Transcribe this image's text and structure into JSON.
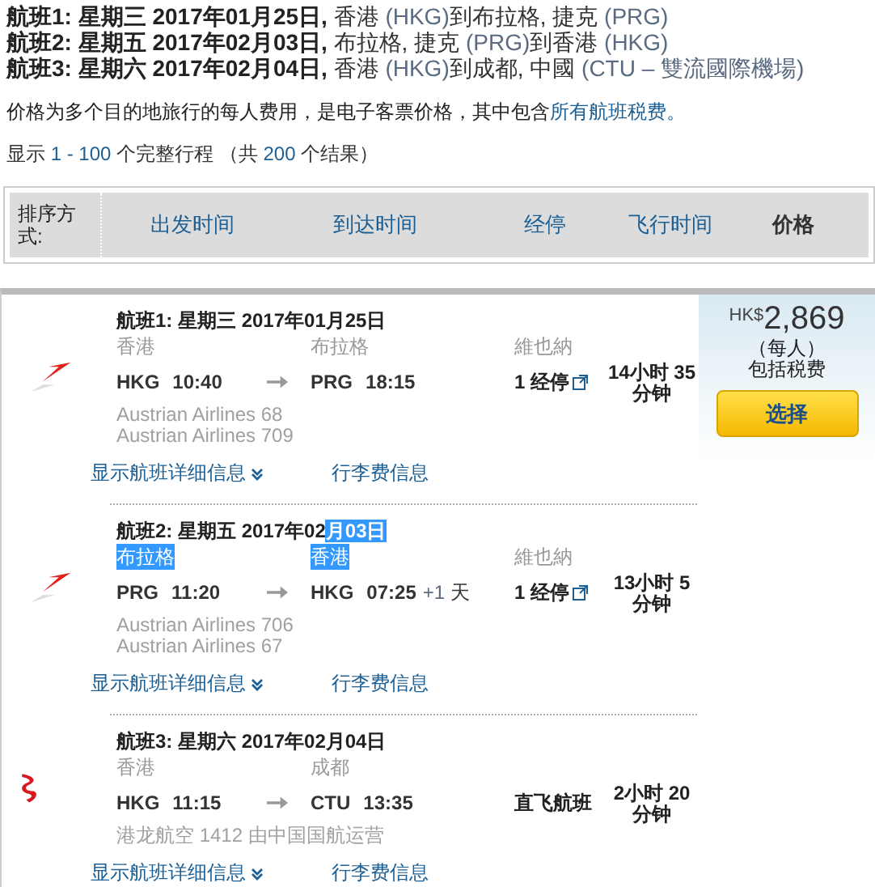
{
  "itinerary_summary": [
    {
      "segments": [
        {
          "text": "航班1: 星期三 2017年01月25日,",
          "kind": "bold"
        },
        {
          "text": " 香港 ",
          "kind": "plain"
        },
        {
          "text": "(HKG)",
          "kind": "code"
        },
        {
          "text": "到布拉格, 捷克 ",
          "kind": "plain"
        },
        {
          "text": "(PRG)",
          "kind": "code"
        }
      ]
    },
    {
      "segments": [
        {
          "text": "航班2: 星期五 2017年02月03日,",
          "kind": "bold"
        },
        {
          "text": " 布拉格, 捷克 ",
          "kind": "plain"
        },
        {
          "text": "(PRG)",
          "kind": "code"
        },
        {
          "text": "到香港 ",
          "kind": "plain"
        },
        {
          "text": "(HKG)",
          "kind": "code"
        }
      ]
    },
    {
      "segments": [
        {
          "text": "航班3: 星期六 2017年02月04日,",
          "kind": "bold"
        },
        {
          "text": " 香港 ",
          "kind": "plain"
        },
        {
          "text": "(HKG)",
          "kind": "code"
        },
        {
          "text": "到成都, 中國 ",
          "kind": "plain"
        },
        {
          "text": "(CTU – 雙流國際機場)",
          "kind": "code"
        }
      ]
    }
  ],
  "notice": {
    "text": "价格为多个目的地旅行的每人费用，是电子客票价格，其中包含",
    "link": "所有航班税费。"
  },
  "results_count": {
    "segments": [
      {
        "text": "显示 ",
        "kind": "plain"
      },
      {
        "text": "1 - 100",
        "kind": "number"
      },
      {
        "text": " 个完整行程 （共 ",
        "kind": "plain"
      },
      {
        "text": "200",
        "kind": "number"
      },
      {
        "text": " 个结果）",
        "kind": "plain"
      }
    ]
  },
  "sort": {
    "label": "排序方式:",
    "options": [
      {
        "label": "出发时间",
        "selected": false
      },
      {
        "label": "到达时间",
        "selected": false
      },
      {
        "label": "经停",
        "selected": false
      },
      {
        "label": "飞行时间",
        "selected": false
      },
      {
        "label": "价格",
        "selected": true
      }
    ]
  },
  "result": {
    "price": {
      "currency": "HK$",
      "amount": "2,869",
      "per_person": "（每人）",
      "tax_note": "包括税费",
      "button": "选择"
    },
    "legs": [
      {
        "kind": "wing",
        "title_parts": [
          {
            "text": "航班1:  星期三 2017年01月25日",
            "highlighted": false
          }
        ],
        "from": {
          "city": "香港",
          "highlighted": false,
          "code": "HKG",
          "time": "10:40"
        },
        "to": {
          "city": "布拉格",
          "highlighted": false,
          "code": "PRG",
          "time": "18:15"
        },
        "via": "維也納",
        "stops": "1 经停",
        "stops_link": true,
        "duration": "14小时 35分钟",
        "flights": [
          "Austrian Airlines 68",
          "Austrian Airlines 709"
        ],
        "details_link": "显示航班详细信息",
        "baggage_link": "行李费信息"
      },
      {
        "kind": "wing",
        "title_parts": [
          {
            "text": "航班2:  星期五 2017年02",
            "highlighted": false
          },
          {
            "text": "月03日",
            "highlighted": true
          }
        ],
        "from": {
          "city": "布拉格",
          "highlighted": true,
          "code": "PRG",
          "time": "11:20"
        },
        "to": {
          "city": "香港",
          "highlighted": true,
          "code": "HKG",
          "time": "07:25",
          "day_offset": "+1",
          "day_unit": "天"
        },
        "via": "維也納",
        "stops": "1 经停",
        "stops_link": true,
        "duration": "13小时 5分钟",
        "flights": [
          "Austrian Airlines 706",
          "Austrian Airlines 67"
        ],
        "details_link": "显示航班详细信息",
        "baggage_link": "行李费信息"
      },
      {
        "kind": "dragon",
        "title_parts": [
          {
            "text": "航班3:  星期六 2017年02月04日",
            "highlighted": false
          }
        ],
        "from": {
          "city": "香港",
          "highlighted": false,
          "code": "HKG",
          "time": "11:15"
        },
        "to": {
          "city": "成都",
          "highlighted": false,
          "code": "CTU",
          "time": "13:35"
        },
        "stops": "直飞航班",
        "stops_link": false,
        "duration": "2小时 20分钟",
        "flights": [
          "港龙航空 1412 由中国国航运营"
        ],
        "details_link": "显示航班详细信息",
        "baggage_link": "行李费信息"
      }
    ]
  }
}
